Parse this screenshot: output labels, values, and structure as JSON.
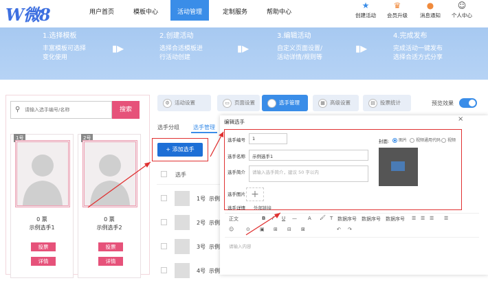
{
  "nav": {
    "logo": "W微8",
    "items": [
      "用户首页",
      "模板中心",
      "活动管理",
      "定制服务",
      "帮助中心"
    ],
    "active_index": 2,
    "right_icons": [
      {
        "label": "创建活动",
        "icon": "star-icon"
      },
      {
        "label": "会员升级",
        "icon": "crown-icon"
      },
      {
        "label": "消息通知",
        "icon": "bell-icon"
      },
      {
        "label": "个人中心",
        "icon": "user-icon"
      }
    ]
  },
  "steps": [
    {
      "title": "1.选择模板",
      "desc1": "丰富模板可选择",
      "desc2": "变化使用"
    },
    {
      "title": "2.创建活动",
      "desc1": "选择合适模板进",
      "desc2": "行活动创建"
    },
    {
      "title": "3.编辑活动",
      "desc1": "自定义页面设置/",
      "desc2": "活动详情/规则等"
    },
    {
      "title": "4.完成发布",
      "desc1": "完成活动一键发布",
      "desc2": "选择合适方式分享"
    }
  ],
  "preview": {
    "search_placeholder": "请输入选手编号/名称",
    "search_button": "搜索",
    "cards": [
      {
        "no": "1号",
        "votes": "0 票",
        "name": "示例选手1",
        "vote_btn": "投票",
        "detail_btn": "详情"
      },
      {
        "no": "2号",
        "votes": "0 票",
        "name": "示例选手2",
        "vote_btn": "投票",
        "detail_btn": "详情"
      }
    ]
  },
  "tabs": [
    {
      "label": "活动设置",
      "icon": "gear-icon"
    },
    {
      "label": "页面设置",
      "icon": "page-icon"
    },
    {
      "label": "选手管理",
      "icon": "person-icon"
    },
    {
      "label": "高级设置",
      "icon": "advanced-icon"
    },
    {
      "label": "投票统计",
      "icon": "stats-icon"
    }
  ],
  "active_tab": 2,
  "preview_effect_label": "预览效果",
  "preview_effect_on": true,
  "subtabs": [
    "选手分组",
    "选手管理"
  ],
  "add_button": "+ 添加选手",
  "table": {
    "column": "选手",
    "rows": [
      {
        "num": "1号",
        "name": "示例"
      },
      {
        "num": "2号",
        "name": "示例"
      },
      {
        "num": "3号",
        "name": "示例"
      },
      {
        "num": "4号",
        "name": "示例"
      }
    ]
  },
  "modal": {
    "title": "编辑选手",
    "close": "×",
    "number_label": "选手编号",
    "number_value": "1",
    "name_label": "选手名称",
    "name_value": "示例选手1",
    "intro_label": "选手简介",
    "intro_placeholder": "请输入选手简介，建议 50 字以内",
    "image_label": "选手图片",
    "detail_label": "选手详情",
    "external_link": "外部链接",
    "cover_label": "封面:",
    "cover_options": [
      "图片",
      "视频通用代码",
      "视频"
    ],
    "cover_selected": 0,
    "editor_placeholder": "请输入内容"
  },
  "editor_toolbar": {
    "row1": [
      "正文",
      "B",
      "I",
      "U",
      "—",
      "A",
      "🖌",
      "T",
      "数据序号",
      "数据序号",
      "数据序号",
      "☰",
      "☰",
      "☰",
      "☰"
    ],
    "row2": [
      "☺",
      "⊙",
      "▣",
      "⊞",
      "⊟",
      "⊠",
      "↶",
      "↷"
    ]
  },
  "colors": {
    "primary": "#3a8de8",
    "accent_pink": "#e6527a",
    "highlight_red": "#e03030",
    "banner": "#abcbf2"
  }
}
